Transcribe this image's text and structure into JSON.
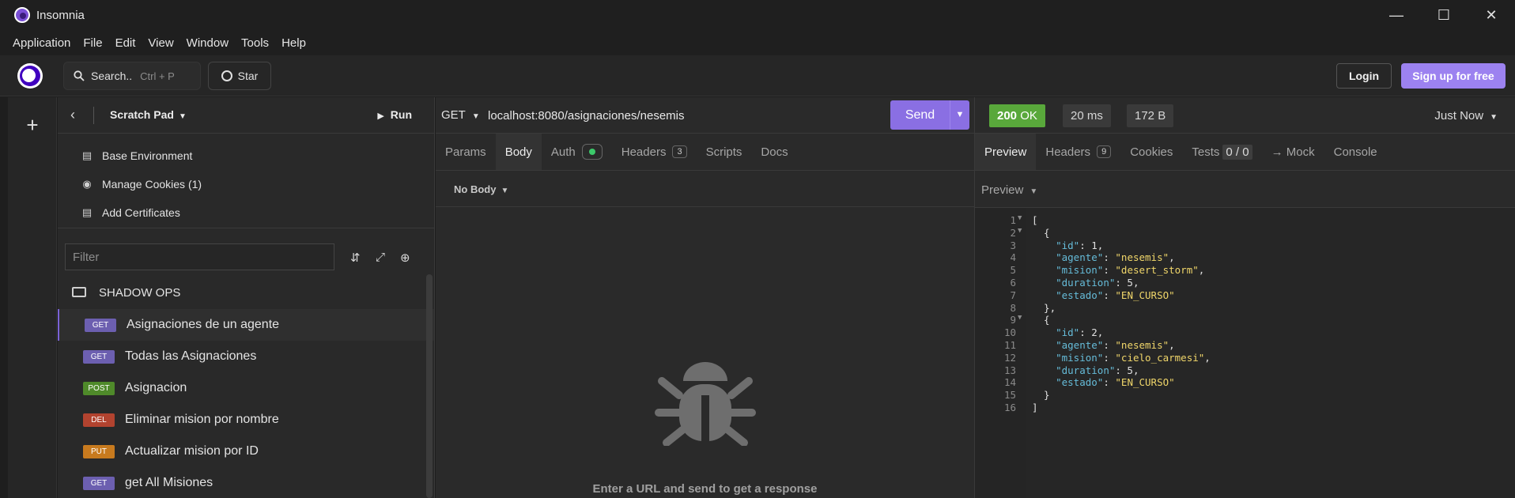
{
  "window": {
    "title": "Insomnia",
    "controls": [
      "minimize",
      "maximize",
      "close"
    ]
  },
  "menu": [
    "Application",
    "File",
    "Edit",
    "View",
    "Window",
    "Tools",
    "Help"
  ],
  "toolbar": {
    "search_label": "Search..",
    "search_shortcut": "Ctrl + P",
    "star_label": "Star",
    "login_label": "Login",
    "signup_label": "Sign up for free"
  },
  "sidebar": {
    "title": "Scratch Pad",
    "run_label": "Run",
    "links": [
      "Base Environment",
      "Manage Cookies (1)",
      "Add Certificates"
    ],
    "filter_placeholder": "Filter",
    "collection": "SHADOW OPS",
    "requests": [
      {
        "method": "GET",
        "name": "Asignaciones de un agente"
      },
      {
        "method": "GET",
        "name": "Todas las Asignaciones"
      },
      {
        "method": "POST",
        "name": "Asignacion"
      },
      {
        "method": "DEL",
        "name": "Eliminar mision por nombre"
      },
      {
        "method": "PUT",
        "name": "Actualizar mision por ID"
      },
      {
        "method": "GET",
        "name": "get All Misiones"
      }
    ]
  },
  "request": {
    "method": "GET",
    "url": "localhost:8080/asignaciones/nesemis",
    "send_label": "Send",
    "tabs": {
      "params": "Params",
      "body": "Body",
      "auth": "Auth",
      "headers": "Headers",
      "headers_count": "3",
      "scripts": "Scripts",
      "docs": "Docs"
    },
    "body_type": "No Body",
    "empty_message": "Enter a URL and send to get a response"
  },
  "response": {
    "status_code": "200",
    "status_text": "OK",
    "time": "20 ms",
    "size": "172 B",
    "timestamp": "Just Now",
    "tabs": {
      "preview": "Preview",
      "headers": "Headers",
      "headers_count": "9",
      "cookies": "Cookies",
      "tests": "Tests",
      "tests_count": "0 / 0",
      "mock": "→ Mock",
      "console": "Console"
    },
    "preview_mode": "Preview",
    "lines": [
      "[",
      "  {",
      "    \"id\": 1,",
      "    \"agente\": \"nesemis\",",
      "    \"mision\": \"desert_storm\",",
      "    \"duration\": 5,",
      "    \"estado\": \"EN_CURSO\"",
      "  },",
      "  {",
      "    \"id\": 2,",
      "    \"agente\": \"nesemis\",",
      "    \"mision\": \"cielo_carmesi\",",
      "    \"duration\": 5,",
      "    \"estado\": \"EN_CURSO\"",
      "  }",
      "]"
    ]
  },
  "colors": {
    "accent": "#8a6fe3",
    "status_ok": "#59a83b",
    "get": "#6c5fb0",
    "post": "#4f8a2a",
    "delete": "#b2432f",
    "put": "#c87a1e"
  }
}
